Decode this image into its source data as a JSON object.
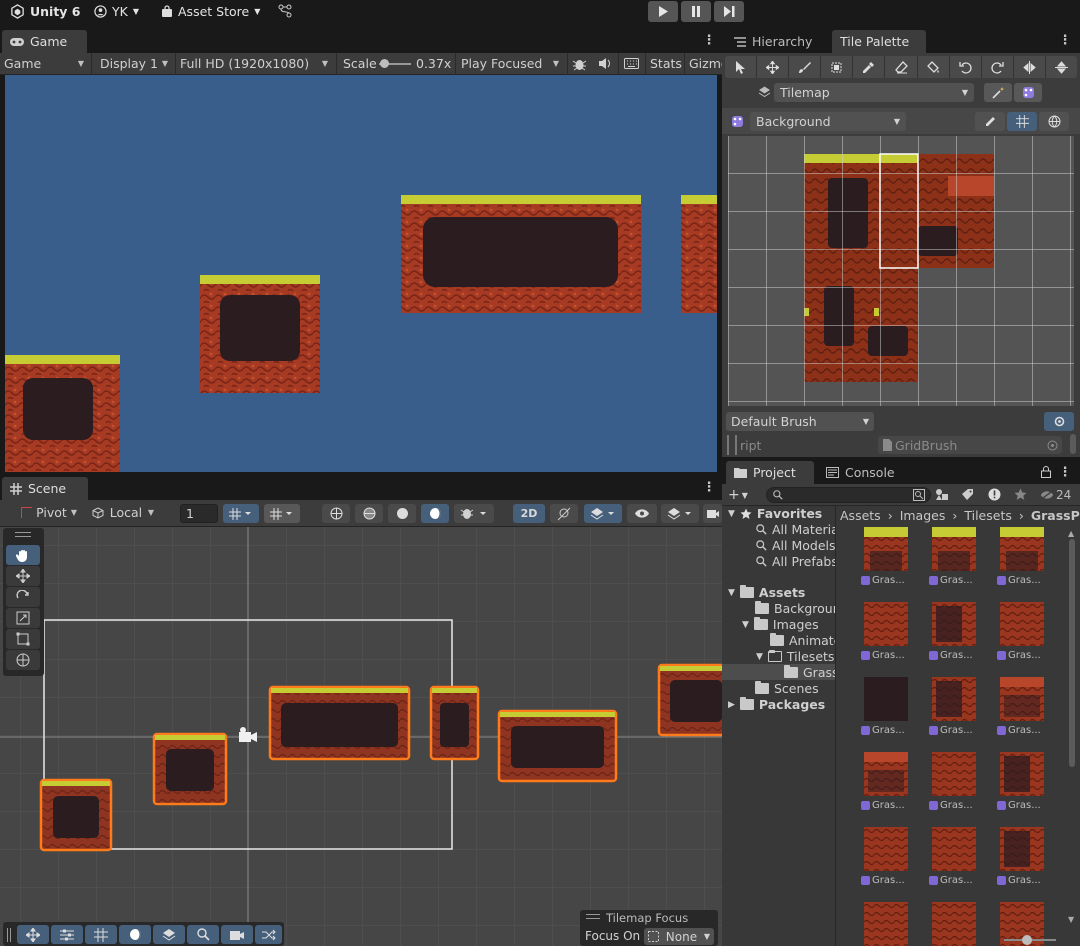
{
  "app": {
    "name": "Unity 6",
    "account": "YK",
    "asset_store": "Asset Store"
  },
  "game_view": {
    "tab_label": "Game",
    "mode": "Game",
    "display": "Display 1",
    "resolution": "Full HD (1920x1080)",
    "scale_label": "Scale",
    "scale_value": "0.37x",
    "play_mode": "Play Focused",
    "stats_label": "Stats",
    "gizmos_label": "Gizmo"
  },
  "scene_view": {
    "tab_label": "Scene",
    "pivot": "Pivot",
    "space": "Local",
    "grid_increment": "1",
    "mode_2d": "2D",
    "tilemap_focus_title": "Tilemap Focus",
    "focus_on_label": "Focus On",
    "focus_on_value": "None"
  },
  "right_panel": {
    "tabs": [
      "Hierarchy",
      "Tile Palette"
    ],
    "active_tab": "Tile Palette",
    "target": "Tilemap",
    "palette": "Background",
    "brush": "Default Brush",
    "script_label": "ript",
    "script_value": "GridBrush"
  },
  "project": {
    "tabs": [
      "Project",
      "Console"
    ],
    "hidden_count": "24",
    "favorites_label": "Favorites",
    "favorites": [
      "All Materials",
      "All Models",
      "All Prefabs"
    ],
    "assets_label": "Assets",
    "folders": [
      {
        "label": "Background",
        "depth": 1
      },
      {
        "label": "Images",
        "depth": 1
      },
      {
        "label": "Animated",
        "depth": 2
      },
      {
        "label": "Tilesets",
        "depth": 2
      },
      {
        "label": "GrassP",
        "depth": 3
      },
      {
        "label": "Scenes",
        "depth": 1
      }
    ],
    "packages_label": "Packages",
    "breadcrumb": [
      "Assets",
      "Images",
      "Tilesets",
      "GrassPla"
    ],
    "asset_label": "Gras..."
  },
  "colors": {
    "game_sky": "#3a5e8c",
    "scene_bg": "#464646",
    "ground_red": "#a5371f",
    "ground_dark": "#2b1c20",
    "grass": "#c6cc33",
    "selection_orange": "#ff7a1a",
    "editor_panel": "#3c3c3c"
  }
}
